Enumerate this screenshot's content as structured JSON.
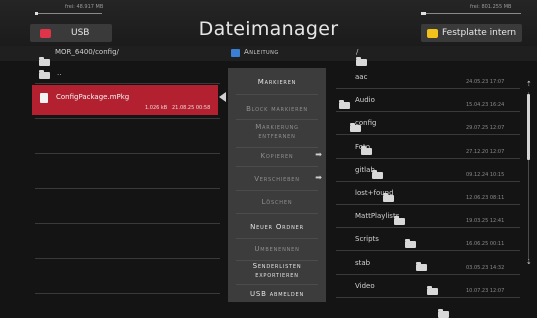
{
  "header": {
    "title": "Dateimanager",
    "left_free": "frei: 48.917 MB",
    "left_bar_fraction": 0.05,
    "left_source": "USB",
    "right_free": "frei: 801.255 MB",
    "right_bar_fraction": 0.05,
    "right_source": "Festplatte intern"
  },
  "paths": {
    "left": "MOR_6400/config/",
    "right": "/",
    "help": "Anleitung"
  },
  "left_panel": {
    "parent_label": "..",
    "selected_file": {
      "name": "ConfigPackage.mPkg",
      "size": "1.026 kB",
      "date": "21.08.25 00:58"
    }
  },
  "menu": {
    "items": [
      {
        "label": "Markieren",
        "enabled": true
      },
      {
        "label": "Block markieren",
        "enabled": false
      },
      {
        "label": "Markierung entfernen",
        "enabled": false
      },
      {
        "label": "Kopieren",
        "enabled": false
      },
      {
        "label": "Verschieben",
        "enabled": false
      },
      {
        "label": "Löschen",
        "enabled": false
      },
      {
        "label": "Neuer Ordner",
        "enabled": true
      },
      {
        "label": "Umbenennen",
        "enabled": false
      },
      {
        "label": "Senderlisten exportieren",
        "enabled": true
      },
      {
        "label": "USB abmelden",
        "enabled": true
      }
    ]
  },
  "right_panel": {
    "items": [
      {
        "name": "aac",
        "date": "24.05.23 17:07"
      },
      {
        "name": "Audio",
        "date": "15.04.23 16:24"
      },
      {
        "name": "config",
        "date": "29.07.25 12:07"
      },
      {
        "name": "Foto",
        "date": "27.12.20 12:07"
      },
      {
        "name": "gitlab",
        "date": "09.12.24 10:15"
      },
      {
        "name": "lost+found",
        "date": "12.06.23 08:11"
      },
      {
        "name": "MattPlaylists",
        "date": "19.03.25 12:41"
      },
      {
        "name": "Scripts",
        "date": "16.06.25 00:11"
      },
      {
        "name": "stab",
        "date": "03.05.23 14:32"
      },
      {
        "name": "Video",
        "date": "10.07.23 12:07"
      }
    ]
  },
  "colors": {
    "selection": "#b3202f",
    "usb_icon": "#e0344a",
    "hdd_icon": "#f2c21a",
    "menu_bg": "#3c3c3c",
    "help_icon": "#3b7fd4"
  }
}
